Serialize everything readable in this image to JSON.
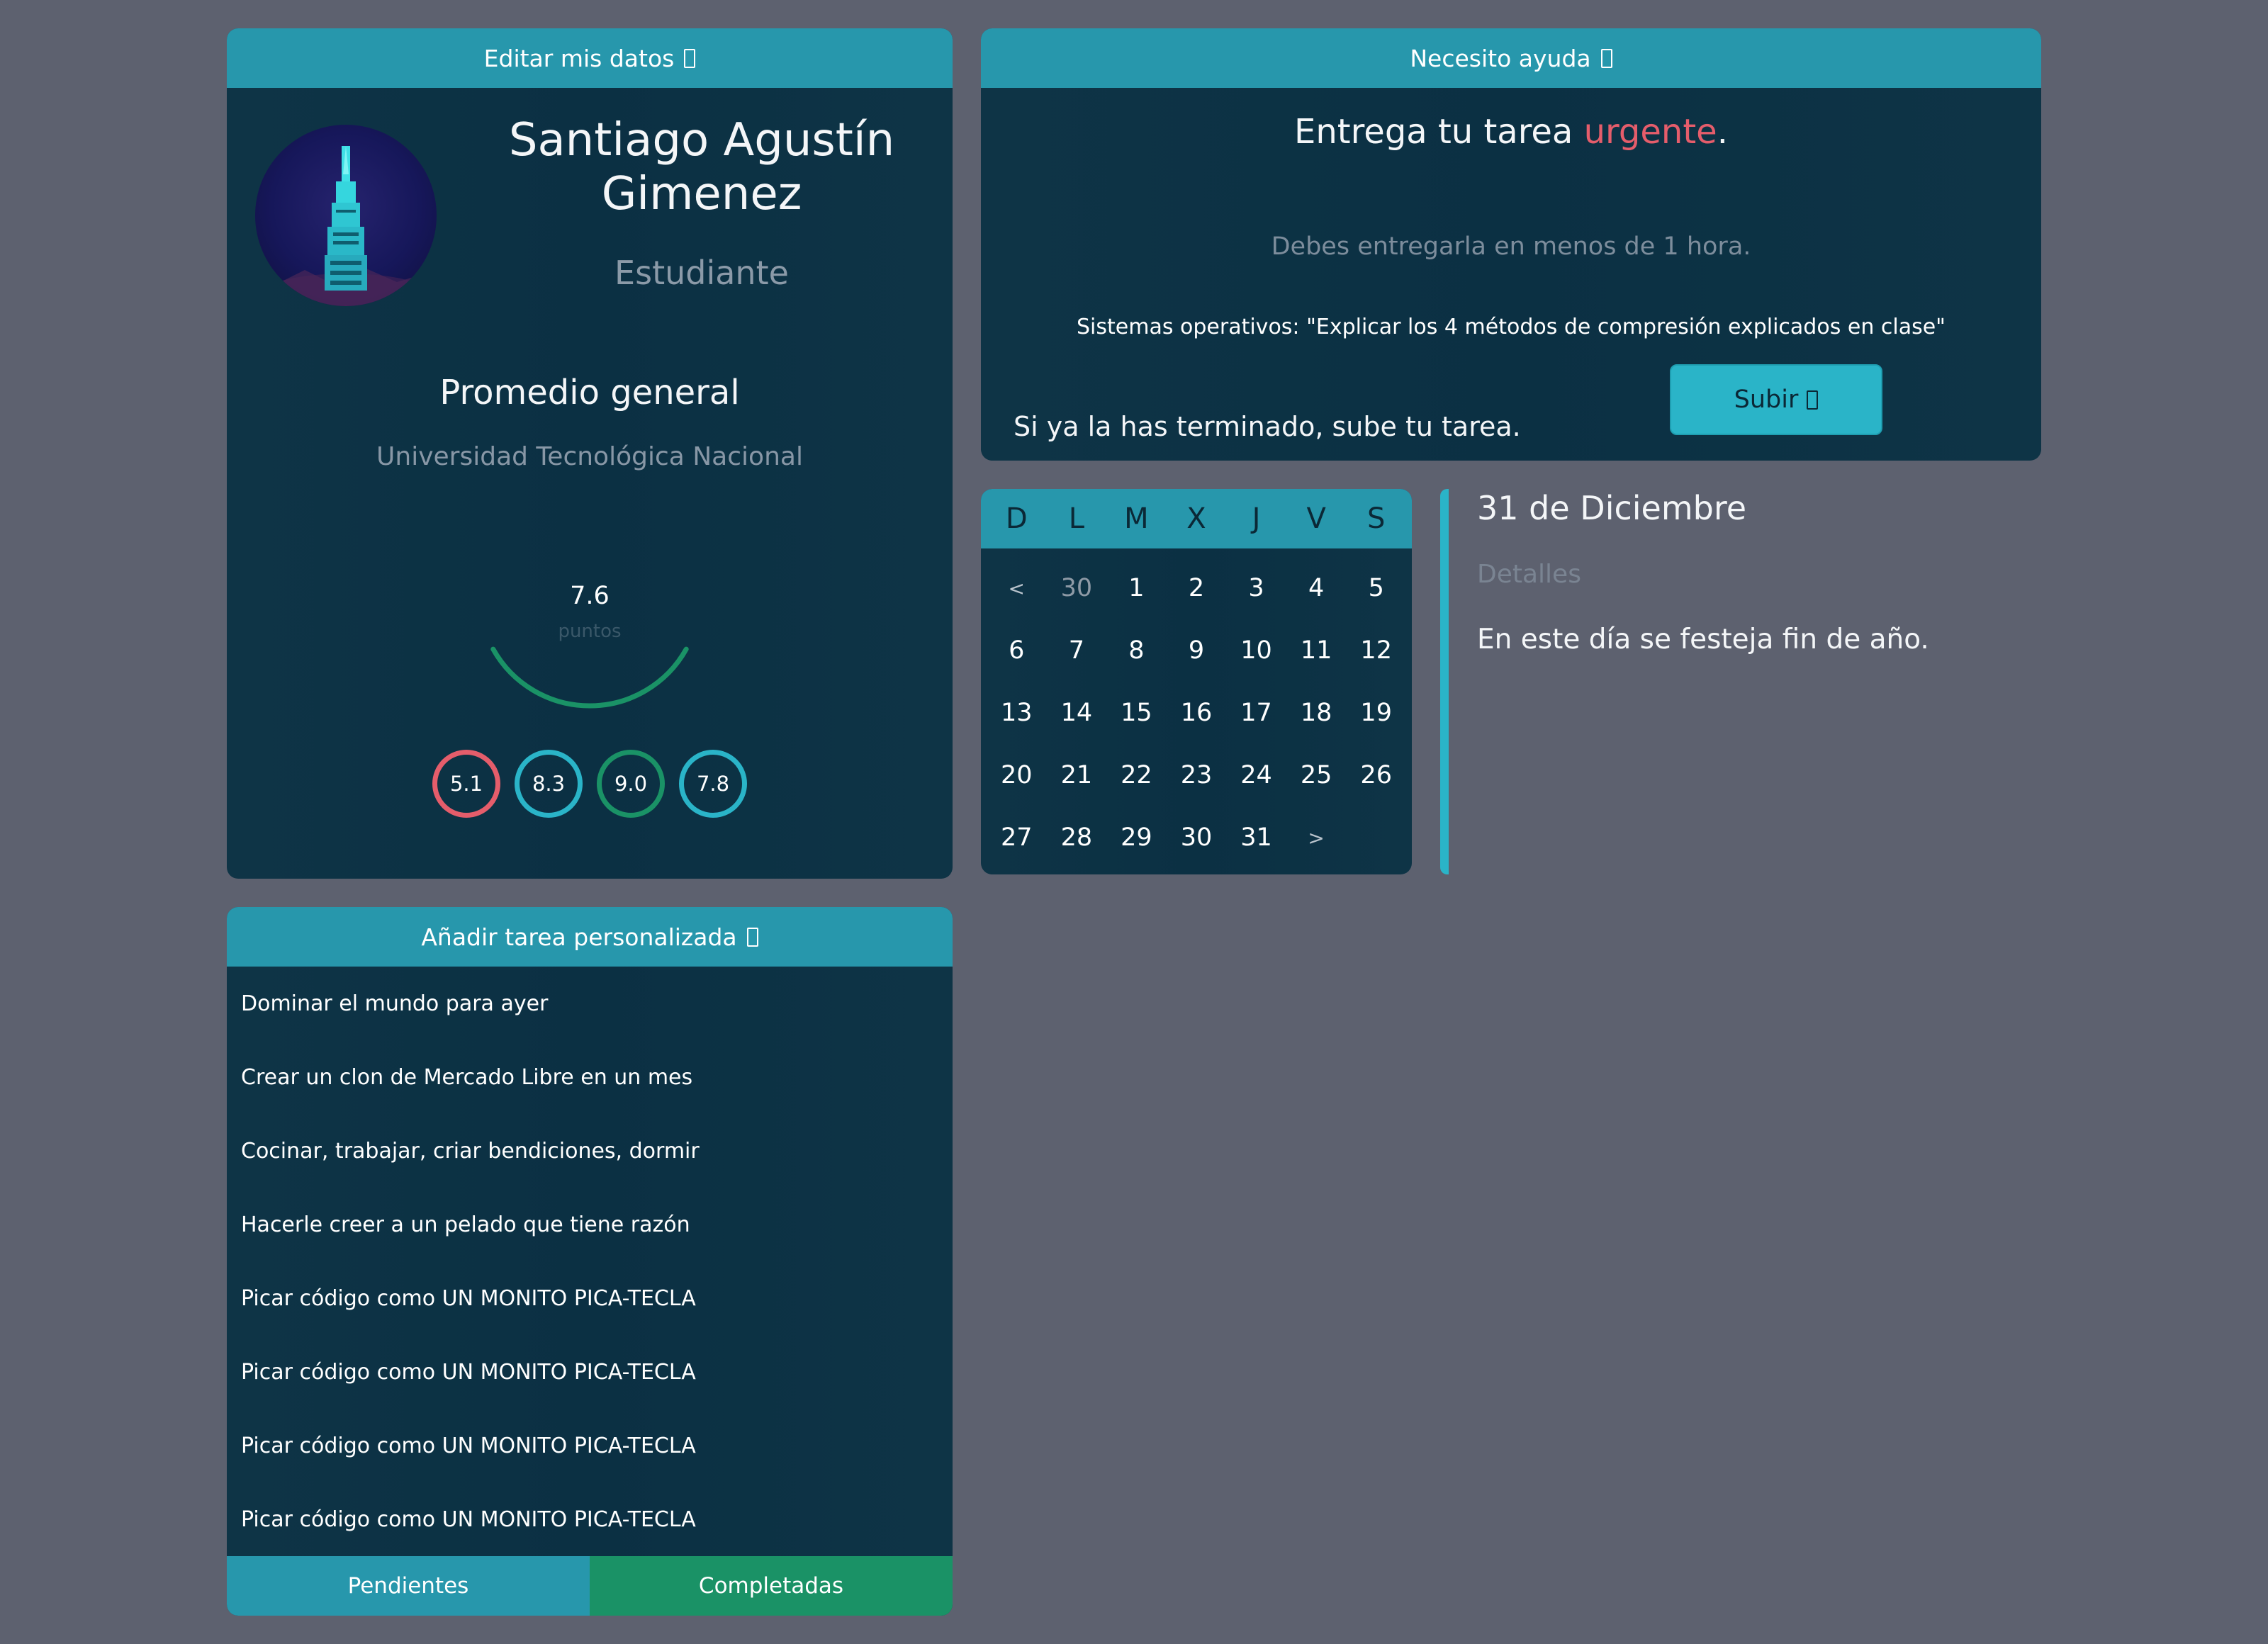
{
  "profile": {
    "header": "Editar mis datos",
    "name": "Santiago Agustín Gimenez",
    "role": "Estudiante",
    "average_title": "Promedio general",
    "university": "Universidad Tecnológica Nacional",
    "average": {
      "value_label": "7.6",
      "value": 7.6,
      "max": 10,
      "unit": "puntos"
    },
    "grades": [
      {
        "label": "5.1",
        "color": "#e55d6b"
      },
      {
        "label": "8.3",
        "color": "#2ab4c8"
      },
      {
        "label": "9.0",
        "color": "#1a9266"
      },
      {
        "label": "7.8",
        "color": "#2ab4c8"
      }
    ]
  },
  "help": {
    "header": "Necesito ayuda",
    "line_prefix": "Entrega tu tarea ",
    "urgent": "urgente",
    "line_suffix": ".",
    "deadline": "Debes entregarla en menos de 1 hora.",
    "task": "Sistemas operativos: \"Explicar los 4 métodos de compresión explicados en clase\"",
    "finished": "Si ya la has terminado, sube tu tarea.",
    "upload_label": "Subir"
  },
  "calendar": {
    "weekdays": [
      "D",
      "L",
      "M",
      "X",
      "J",
      "V",
      "S"
    ],
    "cells": [
      {
        "t": "<",
        "k": "arrow"
      },
      {
        "t": "30",
        "k": "muted"
      },
      {
        "t": "1"
      },
      {
        "t": "2"
      },
      {
        "t": "3"
      },
      {
        "t": "4"
      },
      {
        "t": "5"
      },
      {
        "t": "6"
      },
      {
        "t": "7"
      },
      {
        "t": "8"
      },
      {
        "t": "9"
      },
      {
        "t": "10"
      },
      {
        "t": "11"
      },
      {
        "t": "12"
      },
      {
        "t": "13"
      },
      {
        "t": "14"
      },
      {
        "t": "15"
      },
      {
        "t": "16"
      },
      {
        "t": "17"
      },
      {
        "t": "18"
      },
      {
        "t": "19"
      },
      {
        "t": "20"
      },
      {
        "t": "21"
      },
      {
        "t": "22"
      },
      {
        "t": "23"
      },
      {
        "t": "24"
      },
      {
        "t": "25"
      },
      {
        "t": "26"
      },
      {
        "t": "27"
      },
      {
        "t": "28"
      },
      {
        "t": "29"
      },
      {
        "t": "30"
      },
      {
        "t": "31"
      },
      {
        "t": ">",
        "k": "arrow"
      }
    ]
  },
  "day": {
    "title": "31 de Diciembre",
    "subtitle": "Detalles",
    "text": "En este día se festeja fin de año."
  },
  "tasks": {
    "header": "Añadir tarea personalizada",
    "items": [
      "Dominar el mundo para ayer",
      "Crear un clon de Mercado Libre en un mes",
      "Cocinar, trabajar, criar bendiciones, dormir",
      "Hacerle creer a un pelado que tiene razón",
      "Picar código como UN MONITO PICA-TECLA",
      "Picar código como UN MONITO PICA-TECLA",
      "Picar código como UN MONITO PICA-TECLA",
      "Picar código como UN MONITO PICA-TECLA"
    ],
    "tab_pending": "Pendientes",
    "tab_done": "Completadas"
  },
  "colors": {
    "background": "#5d616f",
    "card": "#0b3043",
    "accent": "#2797ac",
    "accent_light": "#2ab4c8",
    "green": "#1a9266",
    "red": "#e55d6b"
  },
  "icons": {
    "header_icon": "edit-icon",
    "help_icon": "help-icon",
    "upload_icon": "upload-icon",
    "add_icon": "add-icon"
  }
}
